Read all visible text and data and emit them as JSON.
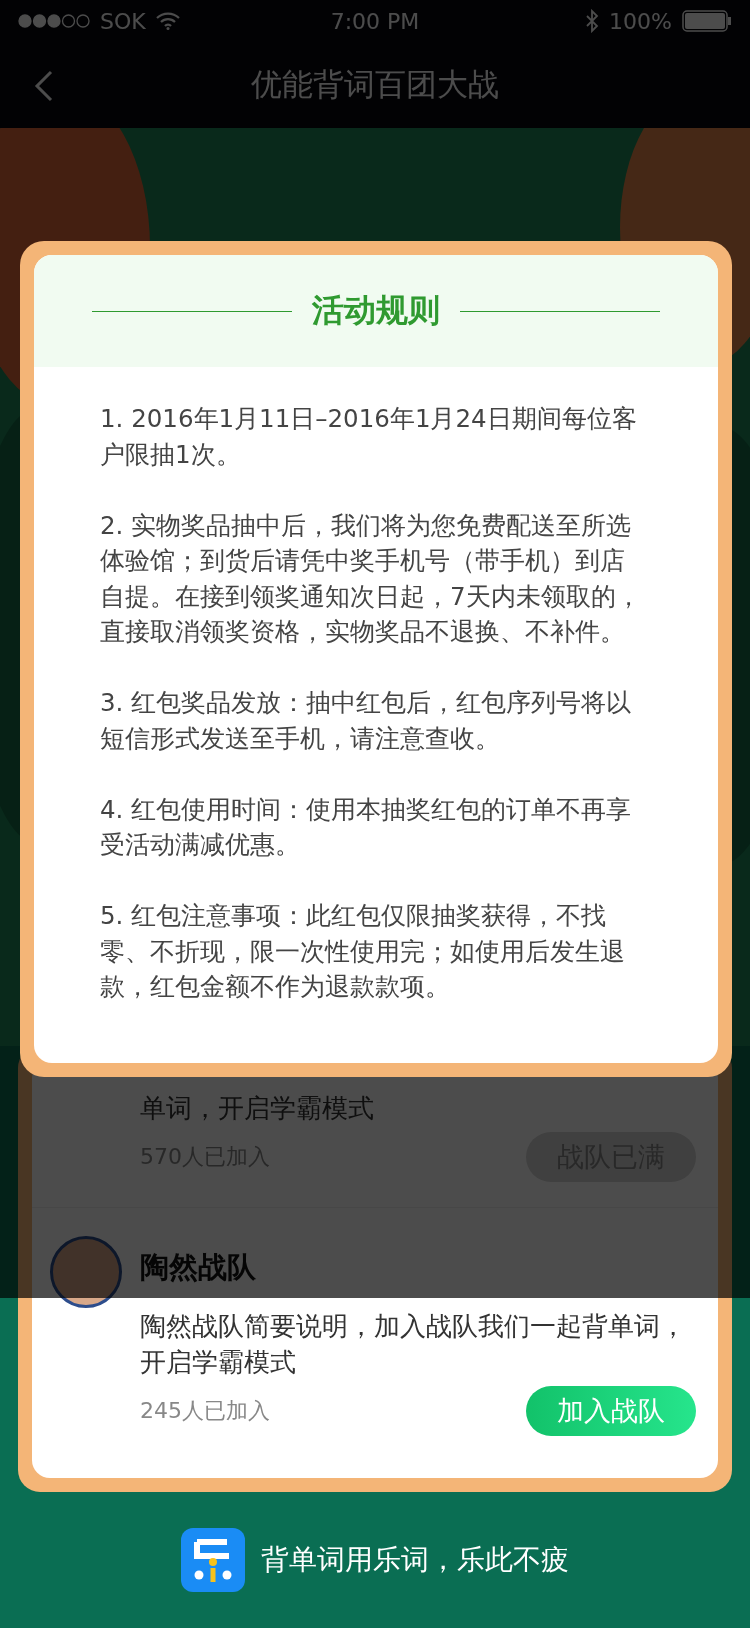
{
  "status_bar": {
    "carrier": "SOK",
    "time": "7:00 PM",
    "battery": "100%"
  },
  "nav": {
    "title": "优能背词百团大战"
  },
  "teams": [
    {
      "description": "单词，开启学霸模式",
      "count": "570人已加入",
      "button": "战队已满",
      "full": true
    },
    {
      "name": "陶然战队",
      "description": "陶然战队简要说明，加入战队我们一起背单词，开启学霸模式",
      "count": "245人已加入",
      "button": "加入战队",
      "full": false
    }
  ],
  "footer": {
    "slogan": "背单词用乐词，乐此不疲"
  },
  "modal": {
    "title": "活动规则",
    "rules": [
      "1. 2016年1月11日–2016年1月24日期间每位客户限抽1次。",
      "2. 实物奖品抽中后，我们将为您免费配送至所选体验馆；到货后请凭中奖手机号（带手机）到店自提。在接到领奖通知次日起，7天内未领取的，直接取消领奖资格，实物奖品不退换、不补件。",
      "3. 红包奖品发放：抽中红包后，红包序列号将以短信形式发送至手机，请注意查收。",
      "4. 红包使用时间：使用本抽奖红包的订单不再享受活动满减优惠。",
      "5. 红包注意事项：此红包仅限抽奖获得，不找零、不折现，限一次性使用完；如使用后发生退款，红包金额不作为退款款项。"
    ]
  }
}
